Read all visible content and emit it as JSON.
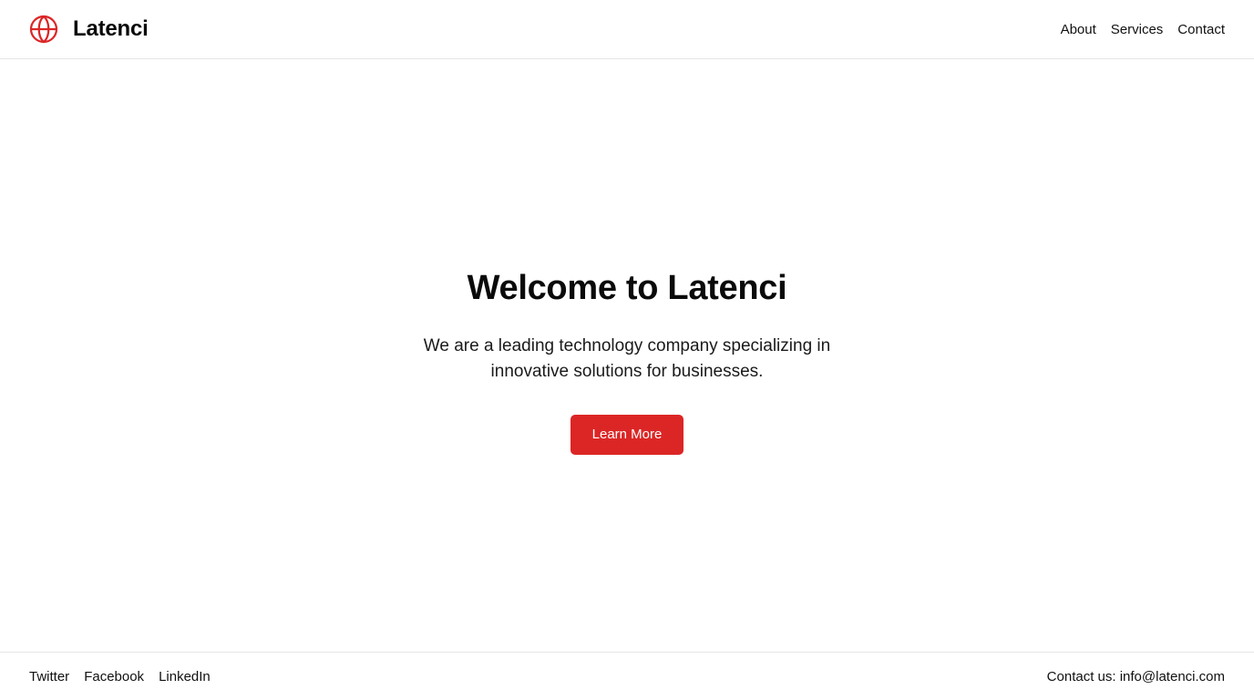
{
  "brand": {
    "name": "Latenci",
    "icon": "globe-icon",
    "accent_color": "#dc2626"
  },
  "nav": {
    "items": [
      {
        "label": "About"
      },
      {
        "label": "Services"
      },
      {
        "label": "Contact"
      }
    ]
  },
  "hero": {
    "title": "Welcome to Latenci",
    "text": "We are a leading technology company specializing in innovative solutions for businesses.",
    "button_label": "Learn More",
    "button_color": "#dc2626"
  },
  "footer": {
    "social": [
      {
        "label": "Twitter"
      },
      {
        "label": "Facebook"
      },
      {
        "label": "LinkedIn"
      }
    ],
    "contact_prefix": "Contact us:",
    "contact_email": "info@latenci.com"
  }
}
